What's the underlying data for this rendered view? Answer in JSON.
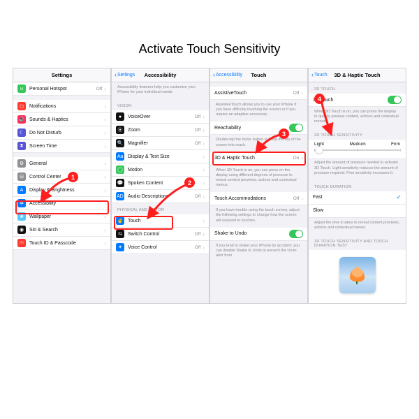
{
  "title": "Activate Touch Sensitivity",
  "callouts": {
    "c1": "1",
    "c2": "2",
    "c3": "3",
    "c4": "4"
  },
  "panel1": {
    "header": "Settings",
    "items": [
      {
        "label": "Personal Hotspot",
        "value": "Off",
        "icon_bg": "#34c759",
        "glyph": "⊍"
      },
      {
        "label": "Notifications",
        "icon_bg": "#ff3b30",
        "glyph": "◻",
        "sep": true
      },
      {
        "label": "Sounds & Haptics",
        "icon_bg": "#ff2d55",
        "glyph": "🔊"
      },
      {
        "label": "Do Not Disturb",
        "icon_bg": "#5856d6",
        "glyph": "☾"
      },
      {
        "label": "Screen Time",
        "icon_bg": "#5856d6",
        "glyph": "⧗"
      },
      {
        "label": "General",
        "icon_bg": "#8e8e93",
        "glyph": "⚙",
        "sep": true
      },
      {
        "label": "Control Center",
        "icon_bg": "#8e8e93",
        "glyph": "⊟"
      },
      {
        "label": "Display & Brightness",
        "icon_bg": "#007aff",
        "glyph": "A"
      },
      {
        "label": "Accessibility",
        "icon_bg": "#007aff",
        "glyph": "✲",
        "highlight": true
      },
      {
        "label": "Wallpaper",
        "icon_bg": "#54c7fc",
        "glyph": "❀"
      },
      {
        "label": "Siri & Search",
        "icon_bg": "#111",
        "glyph": "◉"
      },
      {
        "label": "Touch ID & Passcode",
        "icon_bg": "#ff3b30",
        "glyph": "☉"
      }
    ]
  },
  "panel2": {
    "back": "Settings",
    "header": "Accessibility",
    "intro": "Accessibility features help you customize your iPhone for your individual needs.",
    "group1": "VISION",
    "vision": [
      {
        "label": "VoiceOver",
        "value": "Off",
        "icon_bg": "#111",
        "glyph": "●"
      },
      {
        "label": "Zoom",
        "value": "Off",
        "icon_bg": "#111",
        "glyph": "⦿"
      },
      {
        "label": "Magnifier",
        "value": "Off",
        "icon_bg": "#111",
        "glyph": "🔍"
      },
      {
        "label": "Display & Text Size",
        "icon_bg": "#007aff",
        "glyph": "Aa"
      },
      {
        "label": "Motion",
        "icon_bg": "#34c759",
        "glyph": "◯"
      },
      {
        "label": "Spoken Content",
        "icon_bg": "#111",
        "glyph": "💬"
      },
      {
        "label": "Audio Descriptions",
        "value": "Off",
        "icon_bg": "#007aff",
        "glyph": "AD"
      }
    ],
    "group2": "PHYSICAL AND MOTOR",
    "motor": [
      {
        "label": "Touch",
        "icon_bg": "#007aff",
        "glyph": "☝",
        "highlight": true
      },
      {
        "label": "Switch Control",
        "value": "Off",
        "icon_bg": "#111",
        "glyph": "⇆"
      },
      {
        "label": "Voice Control",
        "value": "Off",
        "icon_bg": "#007aff",
        "glyph": "✦"
      }
    ]
  },
  "panel3": {
    "back": "Accessibility",
    "header": "Touch",
    "rows": {
      "assistive": {
        "label": "AssistiveTouch",
        "value": "Off"
      },
      "assistive_desc": "AssistiveTouch allows you to use your iPhone if you have difficulty touching the screen or if you require an adaptive accessory.",
      "reach": {
        "label": "Reachability"
      },
      "reach_desc": "Double-tap the home button to bring the top of the screen into reach.",
      "haptic": {
        "label": "3D & Haptic Touch",
        "value": "On"
      },
      "haptic_desc": "When 3D Touch is on, you can press on the display using different degrees of pressure to reveal content previews, actions and contextual menus.",
      "accom": {
        "label": "Touch Accommodations",
        "value": "Off"
      },
      "accom_desc": "If you have trouble using the touch screen, adjust the following settings to change how the screen will respond to touches.",
      "shake": {
        "label": "Shake to Undo"
      },
      "shake_desc": "If you tend to shake your iPhone by accident, you can disable Shake to Undo to prevent the Undo alert from"
    }
  },
  "panel4": {
    "back": "Touch",
    "header": "3D & Haptic Touch",
    "group1": "3D TOUCH",
    "toggle_label": "3D Touch",
    "toggle_desc": "When 3D Touch is on, you can press the display to quickly preview content, actions and contextual menus.",
    "group2": "3D TOUCH SENSITIVITY",
    "seg": {
      "a": "Light",
      "b": "Medium",
      "c": "Firm"
    },
    "sens_desc": "Adjust the amount of pressure needed to activate 3D Touch. Light sensitivity reduces the amount of pressure required. Firm sensitivity increases it.",
    "group3": "TOUCH DURATION",
    "fast": "Fast",
    "slow": "Slow",
    "dur_desc": "Adjust the time it takes to reveal content previews, actions and contextual menus.",
    "group4": "3D TOUCH SENSITIVITY AND TOUCH DURATION TEST"
  }
}
